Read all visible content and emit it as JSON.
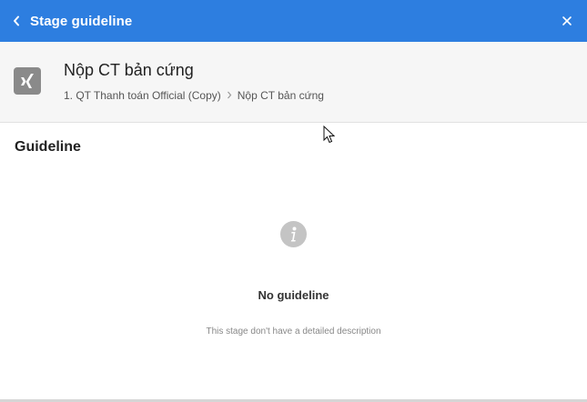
{
  "topbar": {
    "title": "Stage guideline",
    "back_icon": "chevron-left-icon",
    "close_icon": "close-icon",
    "background_color": "#2d7ee0"
  },
  "header": {
    "stage_icon": "xing-icon",
    "stage_title": "Nộp CT bản cứng",
    "breadcrumb": [
      "1. QT Thanh toán Official (Copy)",
      "Nộp CT bản cứng"
    ]
  },
  "guideline": {
    "section_title": "Guideline",
    "empty_icon": "info-icon",
    "empty_title": "No guideline",
    "empty_description": "This stage don't have a detailed description"
  }
}
